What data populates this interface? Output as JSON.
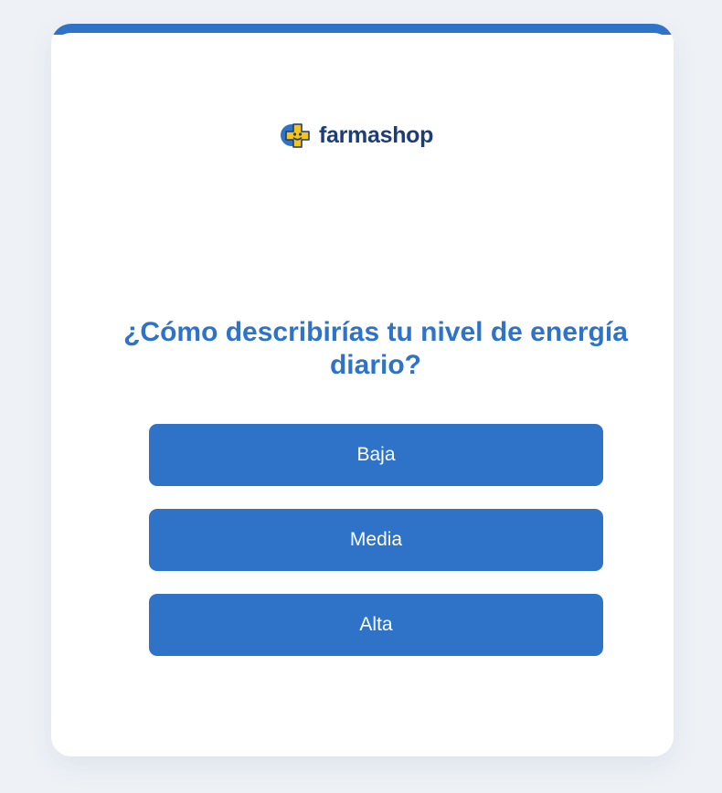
{
  "brand": {
    "name": "farmashop",
    "icon": "farmashop-logo-icon",
    "colors": {
      "primary": "#2e73c8",
      "brand_text": "#1d3d78",
      "logo_yellow": "#f5c518"
    }
  },
  "quiz": {
    "question": "¿Cómo describirías tu nivel de energía diario?",
    "options": [
      {
        "label": "Baja"
      },
      {
        "label": "Media"
      },
      {
        "label": "Alta"
      }
    ]
  }
}
